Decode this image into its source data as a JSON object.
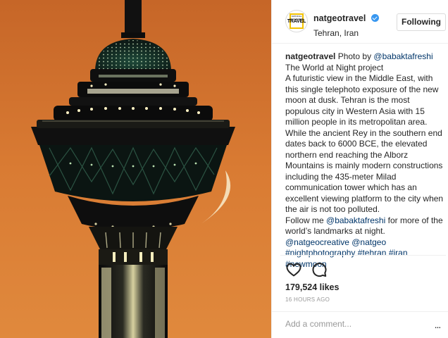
{
  "post": {
    "photo_alt": "Milad Tower at night with crescent moon",
    "header": {
      "username": "natgeotravel",
      "verified": true,
      "location": "Tehran, Iran",
      "follow_label": "Following",
      "avatar": {
        "logo_small": "NATIONAL GEOGRAPHIC",
        "logo_text": "TRAVEL",
        "brand_color": "#f2c200"
      }
    },
    "caption": {
      "username": "natgeotravel",
      "intro": "Photo by",
      "photo_credit": "@babaktafreshi",
      "project": "The World at Night project",
      "body": "A futuristic view in the Middle East, with this single telephoto exposure of the new moon at dusk. Tehran is the most populous city in Western Asia with 15 million people in its metropolitan area. While the ancient Rey in the southern end dates back to 6000 BCE, the elevated northern end reaching the Alborz Mountains is mainly modern constructions including the 435-meter Milad communication tower which has an excellent viewing platform to the city when the air is not too polluted.",
      "follow_prefix": "Follow me",
      "follow_handle": "@babaktafreshi",
      "follow_suffix": "for more of the world’s landmarks at night.",
      "mention_1": "@natgeocreative",
      "mention_2": "@natgeo",
      "hashtag_1": "#nightphotography",
      "hashtag_2": "#tehran",
      "hashtag_3": "#iran",
      "hashtag_4": "#newmoon"
    },
    "actions": {
      "like_icon": "heart-outline-icon",
      "comment_icon": "speech-bubble-icon"
    },
    "likes": "179,524 likes",
    "timestamp": "16 HOURS AGO",
    "comment": {
      "placeholder": "Add a comment...",
      "more_label": "..."
    },
    "colors": {
      "link": "#003569",
      "verified": "#3897f0",
      "sky_top": "#c76a2c",
      "sky_bottom": "#e08a3c"
    }
  }
}
